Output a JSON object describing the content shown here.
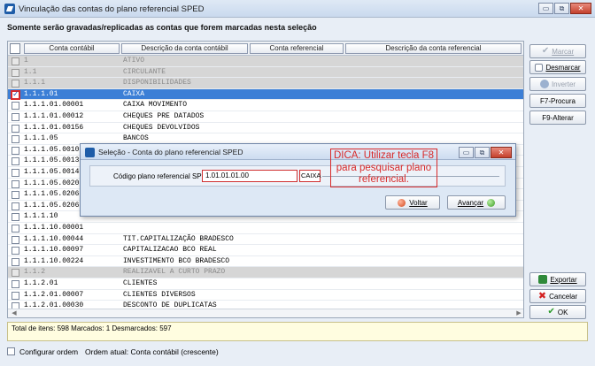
{
  "window": {
    "title": "Vinculação das contas do plano referencial SPED",
    "buttons": [
      "▭",
      "⧉",
      "✕"
    ]
  },
  "notice": "Somente serão gravadas/replicadas as contas que forem marcadas nesta seleção",
  "grid": {
    "columns": [
      "Conta contábil",
      "Descrição da conta contábil",
      "Conta referencial",
      "Descrição da conta referencial"
    ],
    "rows": [
      {
        "code": "1",
        "desc": "ATIVO",
        "group": true,
        "checked": false,
        "selected": false
      },
      {
        "code": "1.1",
        "desc": "CIRCULANTE",
        "group": true,
        "checked": false,
        "selected": false
      },
      {
        "code": "1.1.1",
        "desc": "DISPONIBILIDADES",
        "group": true,
        "checked": false,
        "selected": false
      },
      {
        "code": "1.1.1.01",
        "desc": "CAIXA",
        "group": false,
        "checked": true,
        "selected": true
      },
      {
        "code": "1.1.1.01.00001",
        "desc": "CAIXA MOVIMENTO",
        "group": false,
        "checked": false,
        "selected": false
      },
      {
        "code": "1.1.1.01.00012",
        "desc": "CHEQUES PRE DATADOS",
        "group": false,
        "checked": false,
        "selected": false
      },
      {
        "code": "1.1.1.01.00156",
        "desc": "CHEQUES DEVOLVIDOS",
        "group": false,
        "checked": false,
        "selected": false
      },
      {
        "code": "1.1.1.05",
        "desc": "BANCOS",
        "group": false,
        "checked": false,
        "selected": false
      },
      {
        "code": "1.1.1.05.0010",
        "desc": "",
        "group": false,
        "checked": false,
        "selected": false
      },
      {
        "code": "1.1.1.05.0013",
        "desc": "",
        "group": false,
        "checked": false,
        "selected": false
      },
      {
        "code": "1.1.1.05.0014",
        "desc": "",
        "group": false,
        "checked": false,
        "selected": false
      },
      {
        "code": "1.1.1.05.0020",
        "desc": "",
        "group": false,
        "checked": false,
        "selected": false
      },
      {
        "code": "1.1.1.05.0206",
        "desc": "",
        "group": false,
        "checked": false,
        "selected": false
      },
      {
        "code": "1.1.1.05.0206",
        "desc": "",
        "group": false,
        "checked": false,
        "selected": false
      },
      {
        "code": "1.1.1.10",
        "desc": "",
        "group": false,
        "checked": false,
        "selected": false
      },
      {
        "code": "1.1.1.10.00001",
        "desc": "",
        "group": false,
        "checked": false,
        "selected": false
      },
      {
        "code": "1.1.1.10.00044",
        "desc": "TIT.CAPITALIZAÇÃO BRADESCO",
        "group": false,
        "checked": false,
        "selected": false
      },
      {
        "code": "1.1.1.10.00097",
        "desc": "CAPITALIZACAO BCO REAL",
        "group": false,
        "checked": false,
        "selected": false
      },
      {
        "code": "1.1.1.10.00224",
        "desc": "INVESTIMENTO BCO BRADESCO",
        "group": false,
        "checked": false,
        "selected": false
      },
      {
        "code": "1.1.2",
        "desc": "REALIZAVEL A CURTO PRAZO",
        "group": true,
        "checked": false,
        "selected": false
      },
      {
        "code": "1.1.2.01",
        "desc": "CLIENTES",
        "group": false,
        "checked": false,
        "selected": false
      },
      {
        "code": "1.1.2.01.00007",
        "desc": "CLIENTES DIVERSOS",
        "group": false,
        "checked": false,
        "selected": false
      },
      {
        "code": "1.1.2.01.00030",
        "desc": "DESCONTO DE DUPLICATAS",
        "group": false,
        "checked": false,
        "selected": false
      }
    ]
  },
  "side_buttons": {
    "marcar": "Marcar",
    "desmarcar": "Desmarcar",
    "inverter": "Inverter",
    "procura": "F7-Procura",
    "alterar": "F9-Alterar",
    "exportar": "Exportar",
    "cancelar": "Cancelar",
    "ok": "OK"
  },
  "status": "Total de itens: 598 Marcados: 1 Desmarcados: 597",
  "bottom": {
    "config_label": "Configurar ordem",
    "order_label": "Ordem atual: Conta contábil (crescente)"
  },
  "dialog": {
    "title": "Seleção - Conta do plano referencial SPED",
    "field_label": "Código plano referencial SPED",
    "field_value": "1.01.01.01.00",
    "field_value2": "CAIXA",
    "back_label": "Voltar",
    "next_label": "Avançar"
  },
  "tip": "DICA: Utilizar tecla F8 para pesquisar plano referencial.",
  "colors": {
    "selection": "#3c7fd6",
    "highlight": "#d82a2a"
  }
}
